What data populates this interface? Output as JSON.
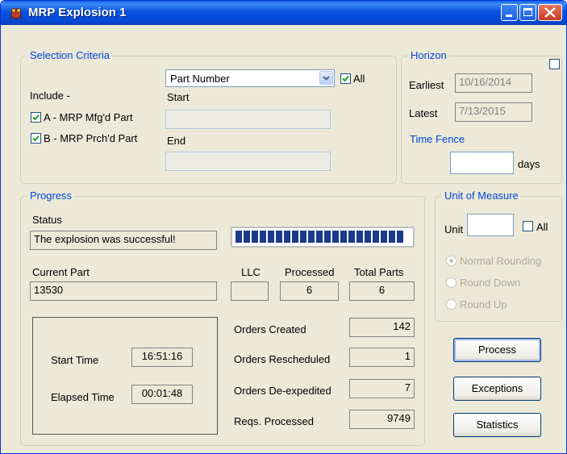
{
  "window": {
    "title": "MRP Explosion 1"
  },
  "selection": {
    "group_label": "Selection Criteria",
    "combo_value": "Part Number",
    "all_label": "All",
    "include_label": "Include -",
    "option_a": "A - MRP Mfg'd Part",
    "option_b": "B - MRP Prch'd Part",
    "start_label": "Start",
    "end_label": "End",
    "start_value": "",
    "end_value": ""
  },
  "horizon": {
    "group_label": "Horizon",
    "earliest_label": "Earliest",
    "earliest_value": "10/16/2014",
    "latest_label": "Latest",
    "latest_value": "7/13/2015",
    "time_fence_label": "Time Fence",
    "time_fence_value": "",
    "days_label": "days"
  },
  "progress": {
    "group_label": "Progress",
    "status_label": "Status",
    "status_value": "The explosion was successful!",
    "progress_fraction": 1.0,
    "current_part_label": "Current Part",
    "current_part_value": "13530",
    "llc_label": "LLC",
    "llc_value": "",
    "processed_label": "Processed",
    "processed_value": "6",
    "total_parts_label": "Total Parts",
    "total_parts_value": "6",
    "start_time_label": "Start Time",
    "start_time_value": "16:51:16",
    "elapsed_time_label": "Elapsed Time",
    "elapsed_time_value": "00:01:48",
    "orders_created_label": "Orders Created",
    "orders_created_value": "142",
    "orders_rescheduled_label": "Orders Rescheduled",
    "orders_rescheduled_value": "1",
    "orders_deexpedited_label": "Orders De-expedited",
    "orders_deexpedited_value": "7",
    "reqs_processed_label": "Reqs. Processed",
    "reqs_processed_value": "9749"
  },
  "uom": {
    "group_label": "Unit of Measure",
    "unit_label": "Unit",
    "unit_value": "",
    "all_label": "All",
    "normal_rounding": "Normal Rounding",
    "round_down": "Round Down",
    "round_up": "Round Up"
  },
  "buttons": {
    "process": "Process",
    "exceptions": "Exceptions",
    "statistics": "Statistics"
  },
  "colors": {
    "title_bar": "#0553e0",
    "group_label": "#0046d5",
    "progress_fill": "#1a3a8c"
  }
}
